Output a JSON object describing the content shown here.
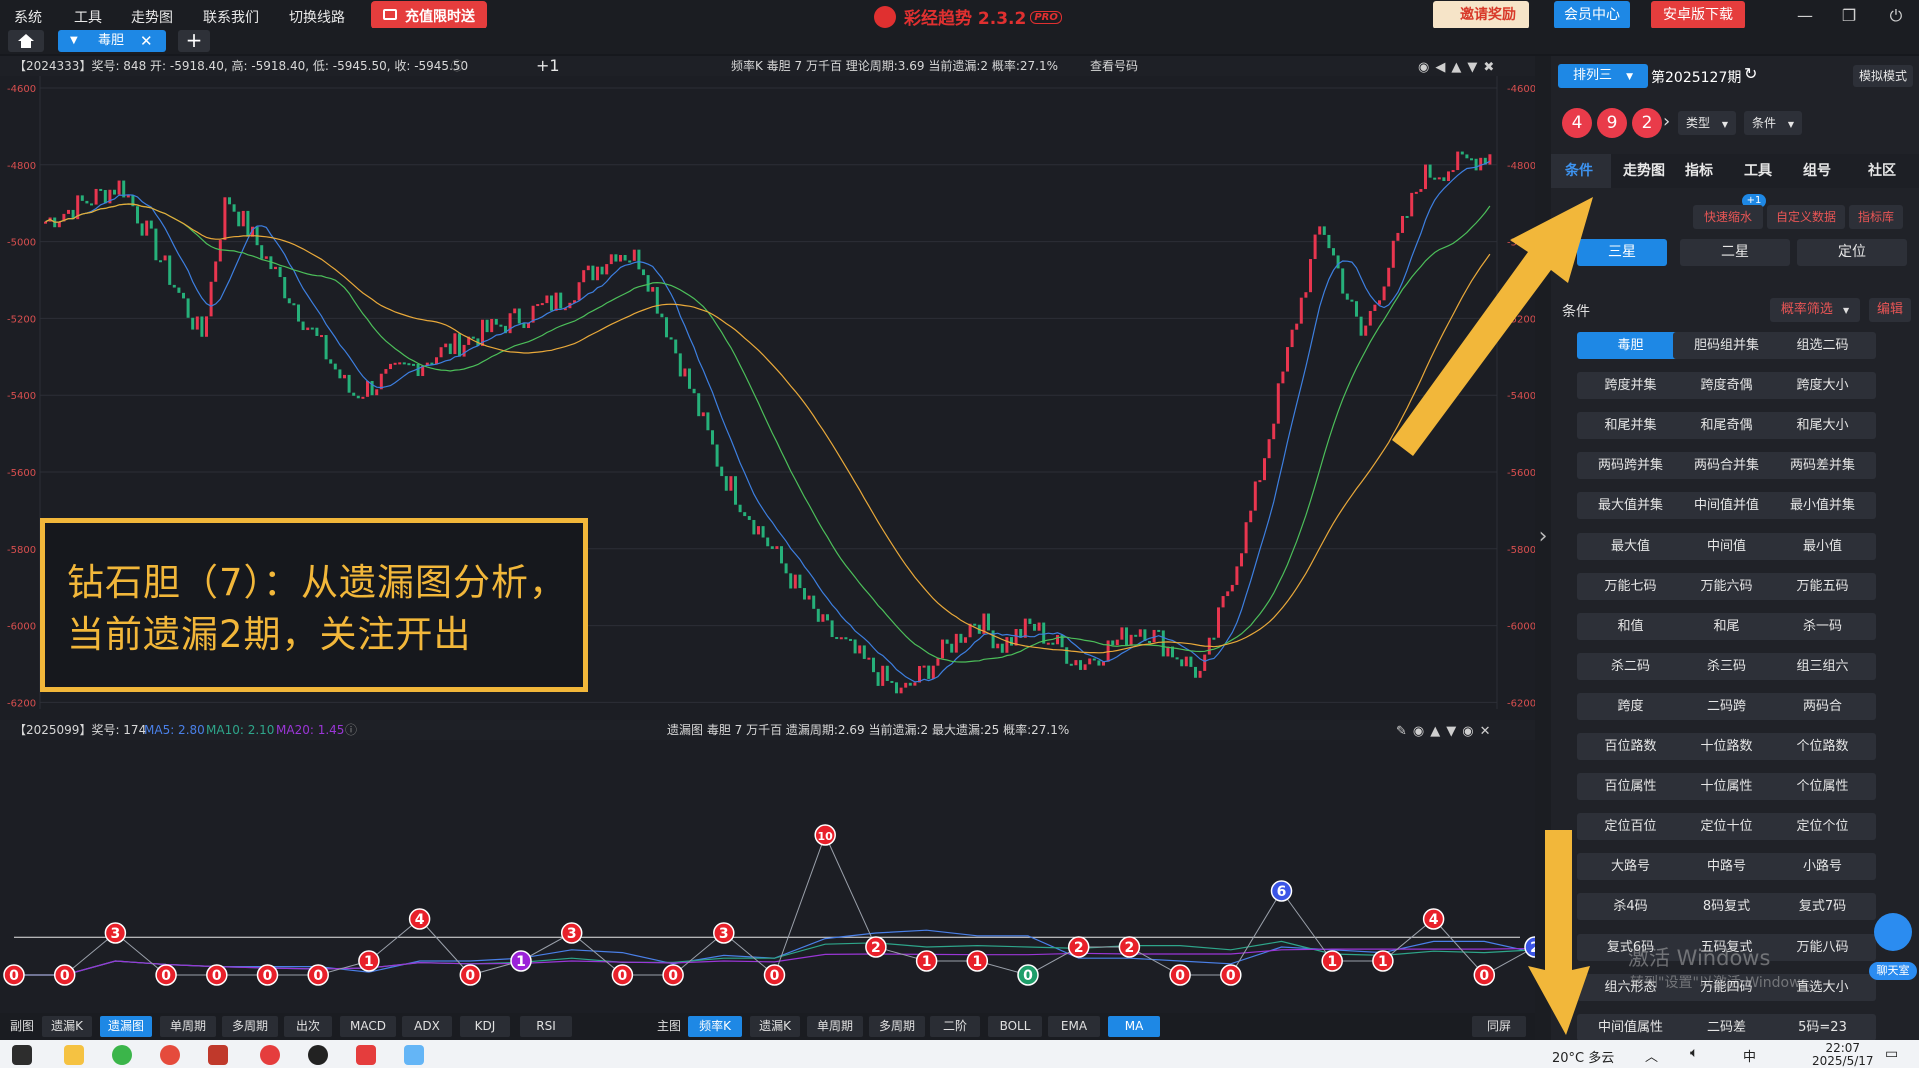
{
  "menu": [
    "系统",
    "工具",
    "走势图",
    "联系我们",
    "切换线路"
  ],
  "promo_label": "充值限时送",
  "app": {
    "title": "彩经趋势 2.3.2",
    "badge": "PRO"
  },
  "top_buttons": {
    "invite": "邀请奖励",
    "member": "会员中心",
    "android": "安卓版下载"
  },
  "tab": {
    "active_label": "毒胆",
    "add": "+"
  },
  "upper_chart": {
    "left_info": "【2024333】奖号: 848  开: -5918.40, 高: -5918.40, 低: -5945.50, 收: -5945.50",
    "center_info": "频率K  毒胆  7  万千百  理论周期:3.69  当前遗漏:2  概率:27.1%",
    "link": "查看号码",
    "y_ticks": [
      "-4600",
      "-4800",
      "-5000",
      "-5200",
      "-5400",
      "-5600",
      "-5800",
      "-6000",
      "-6200"
    ],
    "series_colors": {
      "up": "#e8364f",
      "down": "#26b07a",
      "ma_blue": "#3d7fe0",
      "ma_green": "#4cbf5a",
      "ma_orange": "#e9a93a"
    }
  },
  "lower_chart": {
    "left_info": "【2025099】奖号: 174",
    "ma5": "MA5: 2.80",
    "ma10": "MA10: 2.10",
    "ma20": "MA20: 1.45",
    "center_info": "遗漏图  毒胆  7  万千百  遗漏周期:2.69  当前遗漏:2  最大遗漏:25  概率:27.1%"
  },
  "chart_data": {
    "type": "line",
    "title": "遗漏图  毒胆  7  万千百",
    "series": [
      {
        "values": [
          0,
          0,
          3,
          0,
          0,
          0,
          0,
          1,
          4,
          0,
          1,
          3,
          0,
          0,
          3,
          0,
          10,
          2,
          1,
          1,
          0,
          2,
          2,
          0,
          0,
          6,
          1,
          1,
          4,
          0,
          2
        ]
      }
    ],
    "point_colors": [
      "red",
      "red",
      "red",
      "red",
      "red",
      "red",
      "red",
      "red",
      "red",
      "red",
      "purple",
      "red",
      "red",
      "red",
      "red",
      "red",
      "red",
      "red",
      "red",
      "red",
      "green",
      "red",
      "red",
      "red",
      "red",
      "blue",
      "red",
      "red",
      "red",
      "red",
      "blue"
    ]
  },
  "annotation": [
    "钻石胆（7）：从遗漏图分析，",
    "当前遗漏2期，关注开出"
  ],
  "bottom_toolbar": {
    "sub_label": "副图",
    "sub": [
      "遗漏K",
      "遗漏图",
      "单周期",
      "多周期",
      "出次",
      "MACD",
      "ADX",
      "KDJ",
      "RSI"
    ],
    "main_label": "主图",
    "main": [
      "频率K",
      "遗漏K",
      "单周期",
      "多周期",
      "二阶",
      "BOLL",
      "EMA",
      "MA"
    ],
    "sync": "同屏"
  },
  "right_panel": {
    "lottery": "排列三",
    "issue": "第2025127期",
    "sim_mode": "模拟模式",
    "balls": [
      "4",
      "9",
      "2"
    ],
    "type_select": "类型",
    "cond_select": "条件",
    "tabs": [
      "条件",
      "走势图",
      "指标",
      "工具",
      "组号",
      "社区"
    ],
    "quick": "快速缩水",
    "quick_badge": "+1",
    "custom": "自定义数据",
    "lib": "指标库",
    "modes": [
      "三星",
      "二星",
      "定位"
    ],
    "cond_title": "条件",
    "filter": "概率筛选",
    "edit": "编辑",
    "conditions": [
      "毒胆",
      "胆码组并集",
      "组选二码",
      "跨度并集",
      "跨度奇偶",
      "跨度大小",
      "和尾并集",
      "和尾奇偶",
      "和尾大小",
      "两码跨并集",
      "两码合并集",
      "两码差并集",
      "最大值并集",
      "中间值并值",
      "最小值并集",
      "最大值",
      "中间值",
      "最小值",
      "万能七码",
      "万能六码",
      "万能五码",
      "和值",
      "和尾",
      "杀一码",
      "杀二码",
      "杀三码",
      "组三组六",
      "跨度",
      "二码跨",
      "两码合",
      "百位路数",
      "十位路数",
      "个位路数",
      "百位属性",
      "十位属性",
      "个位属性",
      "定位百位",
      "定位十位",
      "定位个位",
      "大路号",
      "中路号",
      "小路号",
      "杀4码",
      "8码复式",
      "复式7码",
      "复式6码",
      "五码复式",
      "万能八码",
      "组六形态",
      "万能四码",
      "直选大小",
      "中间值属性",
      "二码差",
      "5码=23"
    ],
    "chat": "聊天室"
  },
  "watermark": {
    "line1": "激活 Windows",
    "line2": "转到\"设置\"以激活 Windows。"
  },
  "taskbar": {
    "weather": "20°C 多云",
    "ime": "中",
    "time": "22:07",
    "date": "2025/5/17"
  }
}
